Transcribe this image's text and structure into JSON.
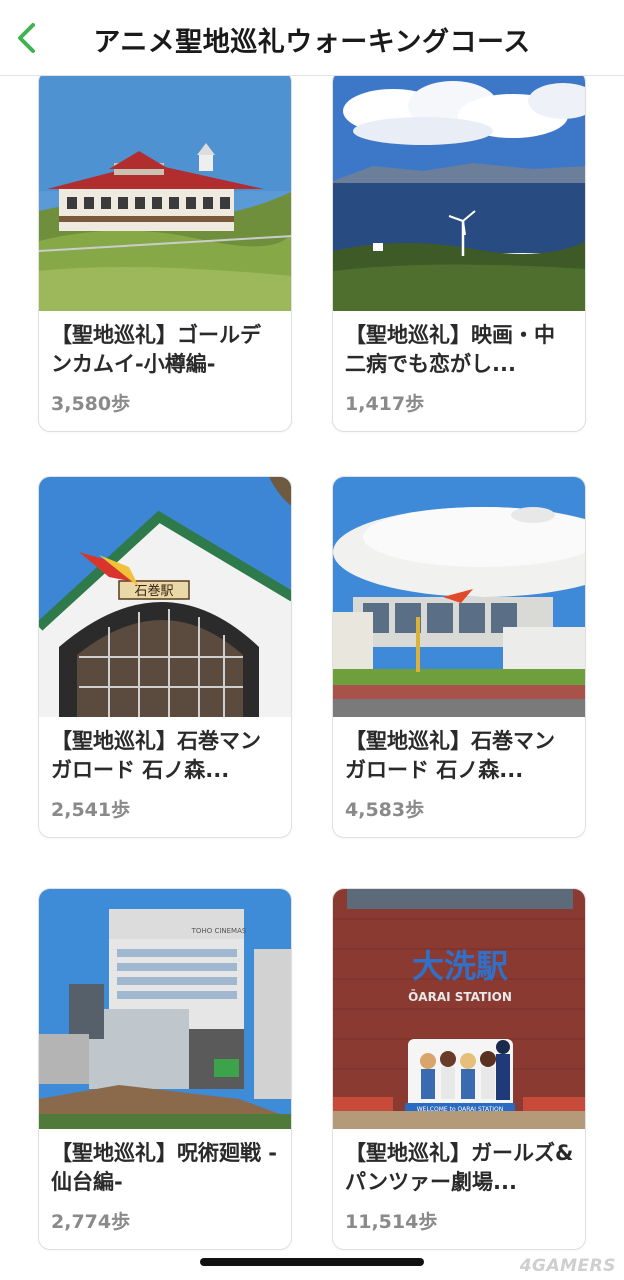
{
  "header": {
    "title": "アニメ聖地巡礼ウォーキングコース",
    "back_icon": "chevron-left-icon",
    "accent_color": "#3fb34f"
  },
  "courses": [
    {
      "title": "【聖地巡礼】ゴールデンカムイ-小樽編-",
      "steps": "3,580歩"
    },
    {
      "title": "【聖地巡礼】映画・中二病でも恋がし...",
      "steps": "1,417歩"
    },
    {
      "title": "【聖地巡礼】石巻マンガロード 石ノ森...",
      "steps": "2,541歩"
    },
    {
      "title": "【聖地巡礼】石巻マンガロード 石ノ森...",
      "steps": "4,583歩"
    },
    {
      "title": "【聖地巡礼】呪術廻戦 -仙台編-",
      "steps": "2,774歩"
    },
    {
      "title": "【聖地巡礼】ガールズ&パンツァー劇場...",
      "steps": "11,514歩"
    }
  ],
  "photo_text": {
    "station_sign": "石巻駅",
    "cinema_sign": "TOHO CINEMAS",
    "oarai_kanji": "大洗駅",
    "oarai_roman": "ŌARAI STATION",
    "oarai_welcome": "WELCOME to OARAI STATION"
  },
  "watermark": "4GAMERS"
}
